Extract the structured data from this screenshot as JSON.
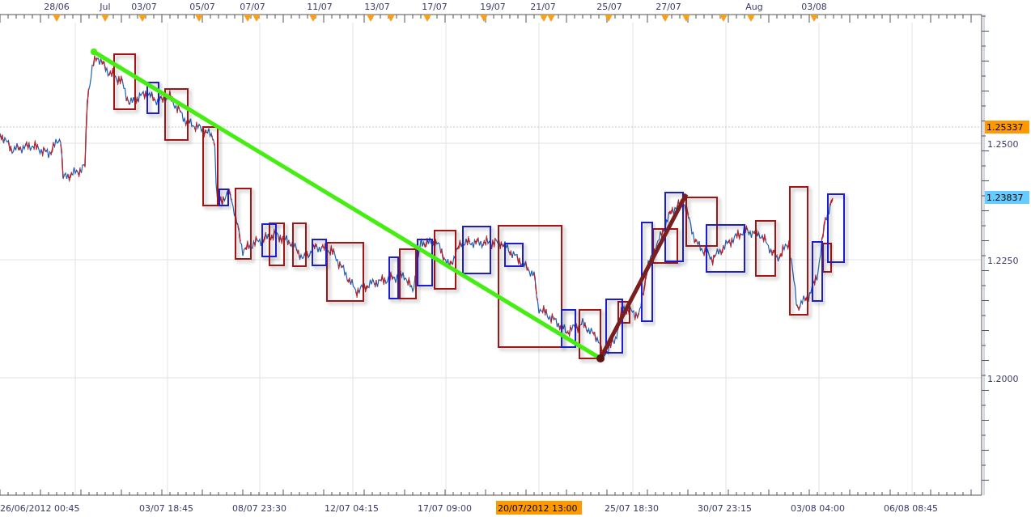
{
  "top_axis": {
    "labels": [
      "28/06",
      "Jul",
      "03/07",
      "05/07",
      "07/07",
      "11/07",
      "13/07",
      "17/07",
      "19/07",
      "21/07",
      "25/07",
      "27/07",
      "Aug",
      "03/08"
    ]
  },
  "price_axis": {
    "labels": [
      {
        "text": "1.25337",
        "kind": "tag",
        "color": "#ff9900"
      },
      {
        "text": "1.2500",
        "kind": "tick"
      },
      {
        "text": "1.23837",
        "kind": "tag",
        "color": "#66ccff"
      },
      {
        "text": "1.2250",
        "kind": "tick"
      },
      {
        "text": "1.2000",
        "kind": "tick"
      }
    ]
  },
  "time_axis": {
    "labels": [
      {
        "text": "26/06/2012 00:45",
        "highlighted": false
      },
      {
        "text": "03/07 18:45",
        "highlighted": false
      },
      {
        "text": "08/07 23:30",
        "highlighted": false
      },
      {
        "text": "12/07 04:15",
        "highlighted": false
      },
      {
        "text": "17/07 09:00",
        "highlighted": false
      },
      {
        "text": "20/07/2012 13:00",
        "highlighted": true
      },
      {
        "text": "25/07 18:30",
        "highlighted": false
      },
      {
        "text": "30/07 23:15",
        "highlighted": false
      },
      {
        "text": "03/08 04:00",
        "highlighted": false
      },
      {
        "text": "06/08 08:45",
        "highlighted": false
      }
    ]
  }
}
